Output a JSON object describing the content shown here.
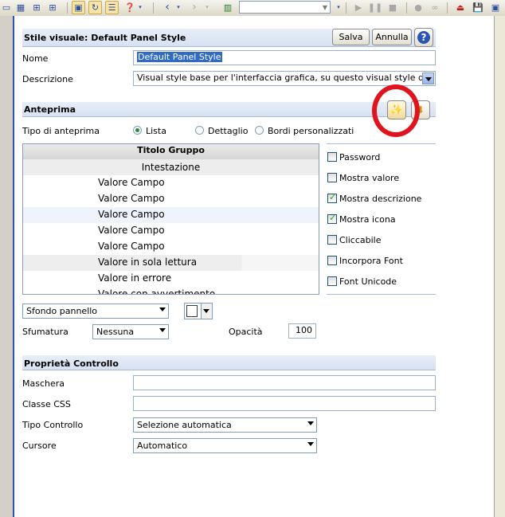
{
  "toolbar": {
    "buttons": [
      {
        "icon": "window-icon"
      },
      {
        "icon": "grid-icon"
      },
      {
        "icon": "grid-split-icon"
      },
      {
        "icon": "form-icon"
      },
      {
        "icon": "refresh-icon"
      },
      {
        "icon": "list-icon"
      },
      {
        "icon": "help-icon"
      },
      {
        "icon": "back-arrow-icon"
      },
      {
        "icon": "forward-arrow-icon"
      },
      {
        "icon": "panel-icon"
      },
      {
        "icon": "play-icon"
      },
      {
        "icon": "pause-icon"
      },
      {
        "icon": "stop-icon"
      },
      {
        "icon": "record-icon"
      },
      {
        "icon": "glasses-icon"
      },
      {
        "icon": "exit-icon"
      },
      {
        "icon": "save-icon"
      },
      {
        "icon": "close-window-icon"
      }
    ],
    "combo_value": ""
  },
  "header": {
    "title": "Stile visuale: Default Panel Style",
    "save_label": "Salva",
    "cancel_label": "Annulla",
    "help_icon": "question-icon"
  },
  "form": {
    "name_label": "Nome",
    "name_value": "Default Panel Style",
    "description_label": "Descrizione",
    "description_value": "Visual style base per l'interfaccia grafica, su questo visual style di"
  },
  "preview_section": {
    "title": "Anteprima",
    "type_label": "Tipo di anteprima",
    "options": [
      "Lista",
      "Dettaglio",
      "Bordi personalizzati"
    ],
    "selected_option": "Lista",
    "group_title": "Titolo Gruppo",
    "heading": "Intestazione",
    "rows": [
      "Valore Campo",
      "Valore Campo",
      "Valore Campo",
      "Valore Campo",
      "Valore Campo",
      "Valore in sola lettura",
      "Valore in errore",
      "Valore con avvertimento"
    ],
    "checkboxes": [
      {
        "label": "Password",
        "checked": false
      },
      {
        "label": "Mostra valore",
        "checked": false
      },
      {
        "label": "Mostra descrizione",
        "checked": true
      },
      {
        "label": "Mostra icona",
        "checked": true
      },
      {
        "label": "Cliccabile",
        "checked": false
      },
      {
        "label": "Incorpora Font",
        "checked": false
      },
      {
        "label": "Font Unicode",
        "checked": false
      }
    ],
    "background_select": "Sfondo pannello",
    "gradient_label": "Sfumatura",
    "gradient_value": "Nessuna",
    "opacity_label": "Opacità",
    "opacity_value": "100"
  },
  "control_section": {
    "title": "Proprietà Controllo",
    "mask_label": "Maschera",
    "mask_value": "",
    "css_label": "Classe CSS",
    "css_value": "",
    "control_type_label": "Tipo Controllo",
    "control_type_value": "Selezione automatica",
    "cursor_label": "Cursore",
    "cursor_value": "Automatico"
  },
  "colors": {
    "accent": "#2a55b5",
    "header_bg": "#dde6f5",
    "highlight_circle": "#e0141e"
  }
}
